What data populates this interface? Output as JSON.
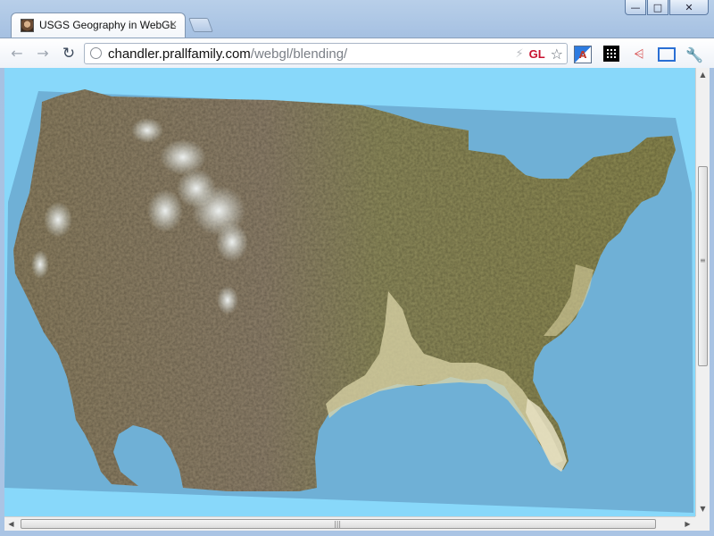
{
  "window": {
    "controls": {
      "minimize": "—",
      "maximize": "□",
      "close": "✕"
    }
  },
  "tab": {
    "title": "USGS Geography in WebGL",
    "close": "×",
    "favicon": "profile-photo-icon"
  },
  "toolbar": {
    "back": "←",
    "forward": "→",
    "reload": "↻",
    "url_host": "chandler.prallfamily.com",
    "url_path": "/webgl/blending/",
    "gl_badge": "GL",
    "bolt": "⚡",
    "star": "☆",
    "share": "⩤",
    "wrench": "🔧"
  },
  "content": {
    "background_color": "#88d8fa",
    "water_color": "#6fb0d6",
    "land_colors": [
      "#8b8a5a",
      "#94866f",
      "#a6a26a",
      "#e7e3c6",
      "#eef2f2"
    ],
    "map_description": "3D terrain of the contiguous United States"
  },
  "scrollbars": {
    "up_arrow": "▲",
    "down_arrow": "▼",
    "left_arrow": "◀",
    "right_arrow": "▶",
    "v_grip": "≡",
    "h_grip": "|||"
  }
}
